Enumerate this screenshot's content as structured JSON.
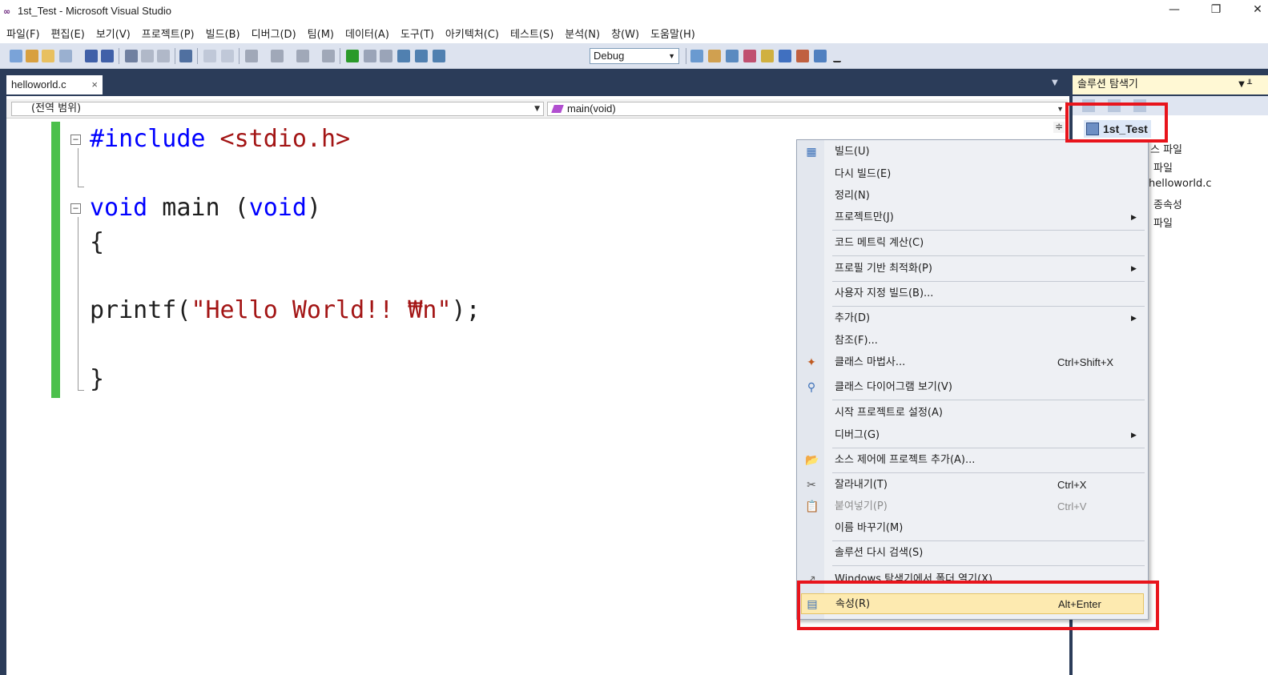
{
  "window": {
    "title": "1st_Test - Microsoft Visual Studio",
    "minimize": "—",
    "restore": "❐",
    "close": "✕"
  },
  "menu": [
    "파일(F)",
    "편집(E)",
    "보기(V)",
    "프로젝트(P)",
    "빌드(B)",
    "디버그(D)",
    "팀(M)",
    "데이터(A)",
    "도구(T)",
    "아키텍처(C)",
    "테스트(S)",
    "분석(N)",
    "창(W)",
    "도움말(H)"
  ],
  "toolbar": {
    "config_value": "Debug"
  },
  "doc_tab": {
    "label": "helloworld.c",
    "close": "×"
  },
  "navbar": {
    "scope": "(전역 범위)",
    "function": "main(void)"
  },
  "code": {
    "line1_kw": "#include",
    "line1_inc": " <stdio.h>",
    "line3_kw1": "void",
    "line3_mid": " main (",
    "line3_kw2": "void",
    "line3_end": ")",
    "line4": "{",
    "line6_fn": "printf(",
    "line6_str": "\"Hello World!! ₩n\"",
    "line6_end": ");",
    "line8": "}"
  },
  "solution_explorer": {
    "header": "솔루션 탐색기",
    "root": "1st_Test",
    "items": [
      "스 파일",
      "파일",
      "helloworld.c",
      "종속성",
      "파일"
    ]
  },
  "context_menu": {
    "items": [
      {
        "label": "빌드(U)",
        "icon": "build-icon"
      },
      {
        "label": "다시 빌드(E)"
      },
      {
        "label": "정리(N)"
      },
      {
        "label": "프로젝트만(J)",
        "submenu": true
      },
      {
        "label": "코드 메트릭 계산(C)"
      },
      {
        "label": "프로필 기반 최적화(P)",
        "submenu": true
      },
      {
        "label": "사용자 지정 빌드(B)..."
      },
      {
        "label": "추가(D)",
        "submenu": true
      },
      {
        "label": "참조(F)..."
      },
      {
        "label": "클래스 마법사...",
        "shortcut": "Ctrl+Shift+X",
        "icon": "class-wizard-icon"
      },
      {
        "label": "클래스 다이어그램 보기(V)",
        "icon": "class-diagram-icon"
      },
      {
        "label": "시작 프로젝트로 설정(A)"
      },
      {
        "label": "디버그(G)",
        "submenu": true
      },
      {
        "label": "소스 제어에 프로젝트 추가(A)...",
        "icon": "add-source-control-icon"
      },
      {
        "label": "잘라내기(T)",
        "shortcut": "Ctrl+X",
        "icon": "scissors-icon"
      },
      {
        "label": "붙여넣기(P)",
        "shortcut": "Ctrl+V",
        "icon": "paste-icon",
        "disabled": true
      },
      {
        "label": "이름 바꾸기(M)"
      },
      {
        "label": "솔루션 다시 검색(S)"
      },
      {
        "label": "Windows 탐색기에서 폴더 열기(X)",
        "icon": "folder-open-icon"
      },
      {
        "label": "속성(R)",
        "shortcut": "Alt+Enter",
        "icon": "properties-icon",
        "highlighted": true
      }
    ],
    "submenu_arrow": "▶"
  },
  "colors": {
    "ide_frame": "#2b3c59",
    "highlight_box": "#e8141c",
    "menu_hover": "#fdeab0"
  }
}
